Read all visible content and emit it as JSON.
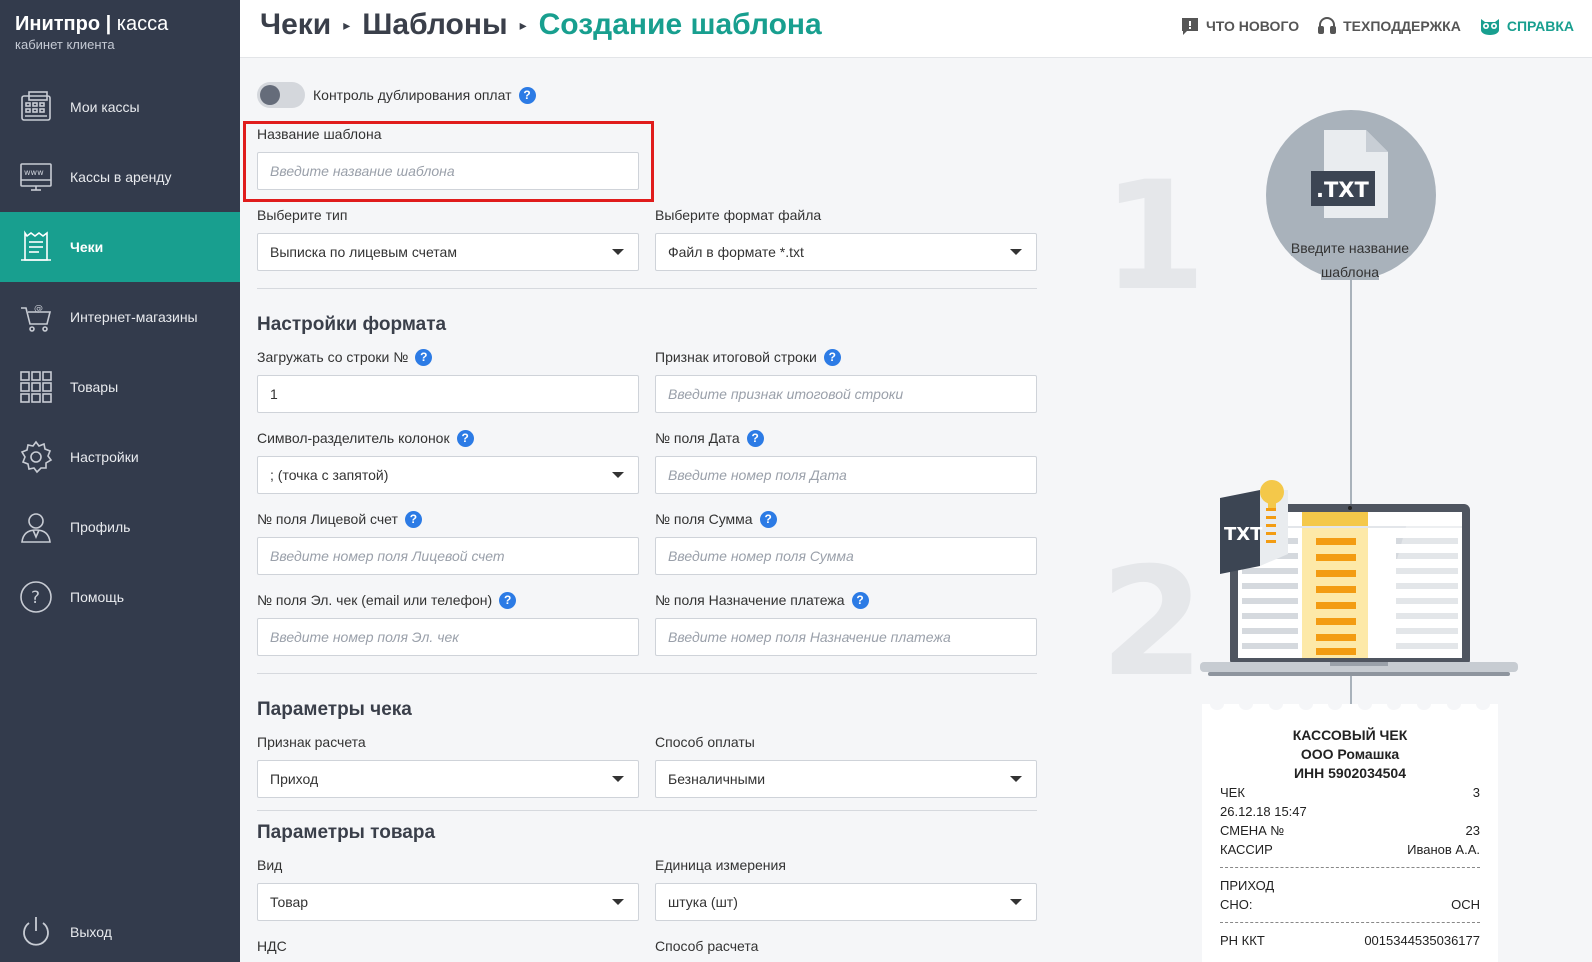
{
  "brand": {
    "name": "Инитпро",
    "sep": " | ",
    "product": "касса",
    "subtitle": "кабинет клиента"
  },
  "sidebar": {
    "items": [
      {
        "label": "Мои кассы",
        "icon": "cash-register-icon"
      },
      {
        "label": "Кассы в аренду",
        "icon": "www-terminal-icon"
      },
      {
        "label": "Чеки",
        "icon": "receipt-icon",
        "active": true
      },
      {
        "label": "Интернет-магазины",
        "icon": "shopping-cart-icon"
      },
      {
        "label": "Товары",
        "icon": "grid-icon"
      },
      {
        "label": "Настройки",
        "icon": "gear-icon"
      },
      {
        "label": "Профиль",
        "icon": "user-icon"
      },
      {
        "label": "Помощь",
        "icon": "question-icon"
      }
    ],
    "logout": {
      "label": "Выход",
      "icon": "power-icon"
    }
  },
  "header": {
    "breadcrumbs": [
      "Чеки",
      "Шаблоны",
      "Создание шаблона"
    ],
    "links": [
      {
        "label": "ЧТО НОВОГО",
        "icon": "news-icon"
      },
      {
        "label": "ТЕХПОДДЕРЖКА",
        "icon": "headset-icon"
      },
      {
        "label": "СПРАВКА",
        "icon": "owl-icon"
      }
    ]
  },
  "form": {
    "duplicate_control": {
      "label": "Контроль дублирования оплат",
      "enabled": false
    },
    "template_name": {
      "label": "Название шаблона",
      "placeholder": "Введите название шаблона"
    },
    "type": {
      "label": "Выберите тип",
      "value": "Выписка по лицевым счетам"
    },
    "file_format": {
      "label": "Выберите формат файла",
      "value": "Файл в формате *.txt"
    },
    "format_section": "Настройки формата",
    "start_row": {
      "label": "Загружать со строки №",
      "value": "1"
    },
    "total_flag": {
      "label": "Признак итоговой строки",
      "placeholder": "Введите признак итоговой строки"
    },
    "separator": {
      "label": "Символ-разделитель колонок",
      "value": "; (точка с запятой)"
    },
    "date_field": {
      "label": "№ поля Дата",
      "placeholder": "Введите номер поля Дата"
    },
    "account_field": {
      "label": "№ поля Лицевой счет",
      "placeholder": "Введите номер поля Лицевой счет"
    },
    "sum_field": {
      "label": "№ поля Сумма",
      "placeholder": "Введите номер поля Сумма"
    },
    "email_field": {
      "label": "№ поля Эл. чек (email или телефон)",
      "placeholder": "Введите номер поля Эл. чек"
    },
    "purpose_field": {
      "label": "№ поля Назначение платежа",
      "placeholder": "Введите номер поля Назначение платежа"
    },
    "receipt_section": "Параметры чека",
    "calc_sign": {
      "label": "Признак расчета",
      "value": "Приход"
    },
    "pay_method": {
      "label": "Способ оплаты",
      "value": "Безналичными"
    },
    "goods_section": "Параметры товара",
    "kind": {
      "label": "Вид",
      "value": "Товар"
    },
    "unit": {
      "label": "Единица измерения",
      "value": "штука (шт)"
    },
    "vat_label": "НДС",
    "calc_method_label": "Способ расчета"
  },
  "illustration": {
    "step1": "1",
    "step2": "2",
    "file_badge": ".TXT",
    "caption": "Введите название шаблона",
    "txt_label": "TXT",
    "receipt": {
      "title": "КАССОВЫЙ ЧЕК",
      "org": "ООО Ромашка",
      "inn": "ИНН 5902034504",
      "rows": [
        {
          "k": "ЧЕК",
          "v": "3"
        },
        {
          "k": "26.12.18 15:47",
          "v": ""
        },
        {
          "k": "СМЕНА №",
          "v": "23"
        },
        {
          "k": "КАССИР",
          "v": "Иванов А.А."
        }
      ],
      "rows2": [
        {
          "k": "ПРИХОД",
          "v": ""
        },
        {
          "k": "СНО:",
          "v": "ОСН"
        }
      ],
      "rn_label": "РН ККТ",
      "rn_value": "0015344535036177"
    }
  },
  "colors": {
    "sidebar_bg": "#333b4c",
    "accent": "#189f8f",
    "help": "#2c7be5",
    "highlight": "#e01c1c"
  }
}
